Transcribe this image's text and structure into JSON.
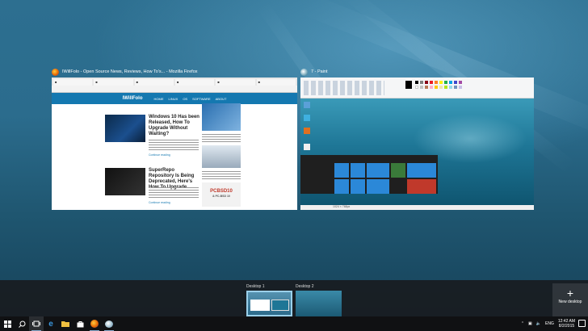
{
  "firefox_window": {
    "title": "IWillFolo - Open Source News, Reviews, How To's... - Mozilla Firefox",
    "site_logo": "IWillFolo",
    "nav_items": [
      "HOME",
      "LINUX",
      "OS",
      "SOFTWARE",
      "ABOUT"
    ],
    "posts": [
      {
        "title": "Windows 10 Has been Released, How To Upgrade Without Waiting?",
        "more": "Continue reading"
      },
      {
        "title": "SuperRepo Repository Is Being Deprecated, Here's How To Upgrade",
        "more": "Continue reading"
      }
    ],
    "ad_text": "PCBSD10",
    "ad_sub": "& PC-BSD 10"
  },
  "paint_window": {
    "title": "7 - Paint",
    "status_text": "1024 × 768px"
  },
  "task_view": {
    "desktops": [
      {
        "label": "Desktop 1"
      },
      {
        "label": "Desktop 2"
      }
    ],
    "new_desktop_label": "New desktop",
    "new_desktop_symbol": "+"
  },
  "taskbar": {
    "apps": [
      "start-icon",
      "search-icon",
      "task-view-icon",
      "edge-icon",
      "file-explorer-icon",
      "store-icon",
      "firefox-icon",
      "paint-icon"
    ],
    "tray": {
      "language": "ENG",
      "time": "12:42 AM",
      "date": "8/2/2015"
    }
  },
  "colors": {
    "taskbar": "#101113",
    "band": "#1c1f23",
    "accent": "#9ad0ea",
    "firefox_nav": "#1478b0"
  }
}
